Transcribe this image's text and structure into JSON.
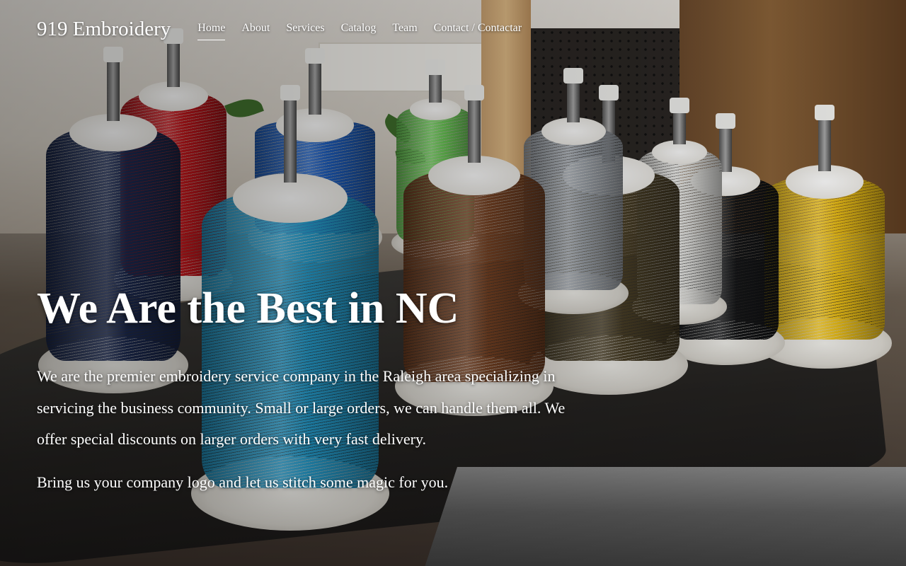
{
  "site": {
    "brand": "919 Embroidery"
  },
  "nav": {
    "items": [
      {
        "label": "Home",
        "active": true
      },
      {
        "label": "About",
        "active": false
      },
      {
        "label": "Services",
        "active": false
      },
      {
        "label": "Catalog",
        "active": false
      },
      {
        "label": "Team",
        "active": false
      },
      {
        "label": "Contact / Contactar",
        "active": false
      }
    ]
  },
  "hero": {
    "title": "We Are the Best in NC",
    "paragraph_1": "We are the premier embroidery service company in the Raleigh area specializing in servicing the business community. Small or large orders, we can handle them all. We offer special discounts on larger orders with very fast delivery.",
    "paragraph_2": "Bring us your company logo and let us stitch some magic for you.",
    "background_image": "thread-spools-photo",
    "spool_colors": [
      "#1d2c55",
      "#c8151b",
      "#1f63c9",
      "#28a6d9",
      "#6fd25a",
      "#7a4424",
      "#a3a9b0",
      "#4c4128",
      "#e9e9e6",
      "#151618",
      "#f2c418"
    ]
  }
}
